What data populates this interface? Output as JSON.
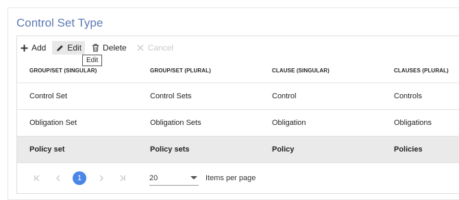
{
  "title": "Control Set Type",
  "toolbar": {
    "add_label": "Add",
    "edit_label": "Edit",
    "delete_label": "Delete",
    "cancel_label": "Cancel"
  },
  "tooltip": "Edit",
  "table": {
    "columns": [
      "GROUP/SET (SINGULAR)",
      "GROUP/SET (PLURAL)",
      "CLAUSE (SINGULAR)",
      "CLAUSES (PLURAL)"
    ],
    "rows": [
      [
        "Control Set",
        "Control Sets",
        "Control",
        "Controls"
      ],
      [
        "Obligation Set",
        "Obligation Sets",
        "Obligation",
        "Obligations"
      ],
      [
        "Policy set",
        "Policy sets",
        "Policy",
        "Policies"
      ]
    ]
  },
  "pager": {
    "current_page": "1",
    "page_size": "20",
    "items_per_page_label": "Items per page"
  },
  "colors": {
    "title": "#5b79b4",
    "page_active": "#4a86e8",
    "selected_row": "#eaeaea"
  }
}
